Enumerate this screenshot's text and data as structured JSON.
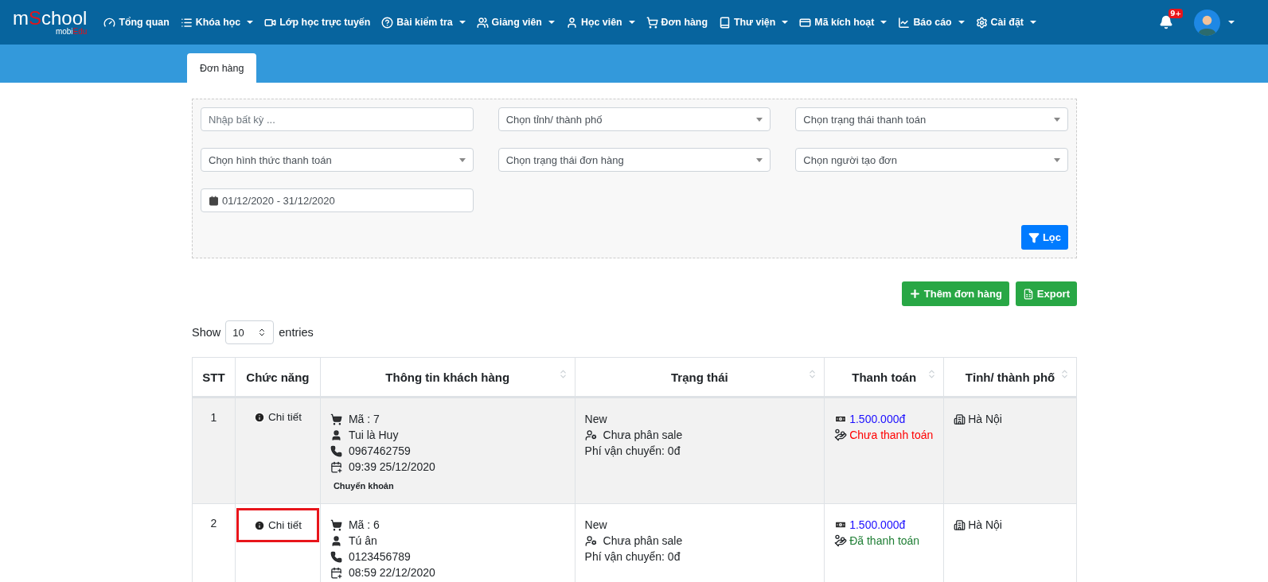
{
  "logo": {
    "before": "m",
    "accent": "S",
    "after": "chool",
    "sub_before": "mobi",
    "sub_accent": "Edu"
  },
  "nav": [
    {
      "label": "Tổng quan",
      "dropdown": false
    },
    {
      "label": "Khóa học",
      "dropdown": true
    },
    {
      "label": "Lớp học trực tuyến",
      "dropdown": false
    },
    {
      "label": "Bài kiểm tra",
      "dropdown": true
    },
    {
      "label": "Giảng viên",
      "dropdown": true
    },
    {
      "label": "Học viên",
      "dropdown": true
    },
    {
      "label": "Đơn hàng",
      "dropdown": false
    },
    {
      "label": "Thư viện",
      "dropdown": true
    },
    {
      "label": "Mã kích hoạt",
      "dropdown": true
    },
    {
      "label": "Báo cáo",
      "dropdown": true
    },
    {
      "label": "Cài đặt",
      "dropdown": true
    }
  ],
  "notifications": {
    "badge": "9+"
  },
  "tabs": [
    {
      "label": "Đơn hàng",
      "selected": true
    }
  ],
  "filters": [
    {
      "kind": "text",
      "placeholder": "Nhập bất kỳ ..."
    },
    {
      "kind": "select",
      "placeholder": "Chọn tỉnh/ thành phố"
    },
    {
      "kind": "select",
      "placeholder": "Chọn trạng thái thanh toán"
    },
    {
      "kind": "select",
      "placeholder": "Chọn hình thức thanh toán"
    },
    {
      "kind": "select",
      "placeholder": "Chọn trạng thái đơn hàng"
    },
    {
      "kind": "select",
      "placeholder": "Chọn người tạo đơn"
    },
    {
      "kind": "date",
      "value": "01/12/2020 - 31/12/2020"
    }
  ],
  "filter_button": "Lọc",
  "actions": [
    {
      "label": "Thêm đơn hàng"
    },
    {
      "label": "Export"
    }
  ],
  "length": {
    "before": "Show",
    "value": "10",
    "after": "entries"
  },
  "table": {
    "columns": [
      {
        "label": "STT",
        "sortable": false
      },
      {
        "label": "Chức năng",
        "sortable": false
      },
      {
        "label": "Thông tin khách hàng",
        "sortable": true
      },
      {
        "label": "Trạng thái",
        "sortable": true
      },
      {
        "label": "Thanh toán",
        "sortable": true
      },
      {
        "label": "Tỉnh/ thành phố",
        "sortable": true
      }
    ],
    "rows": [
      {
        "stt": "1",
        "action": "Chi tiết",
        "highlighted": false,
        "code": "Mã : 7",
        "name": "Tui là Huy",
        "phone": "0967462759",
        "date": "09:39 25/12/2020",
        "method": "Chuyển khoản",
        "status": "New",
        "sale": "Chưa phân sale",
        "shipping": "Phí vận chuyển: 0đ",
        "amount": "1.500.000đ",
        "payment": "Chưa thanh toán",
        "paid": false,
        "city": "Hà Nội"
      },
      {
        "stt": "2",
        "action": "Chi tiết",
        "highlighted": true,
        "code": "Mã : 6",
        "name": "Tú ân",
        "phone": "0123456789",
        "date": "08:59 22/12/2020",
        "status": "New",
        "sale": "Chưa phân sale",
        "shipping": "Phí vận chuyển: 0đ",
        "amount": "1.500.000đ",
        "payment": "Đã thanh toán",
        "paid": true,
        "city": "Hà Nội"
      }
    ]
  }
}
